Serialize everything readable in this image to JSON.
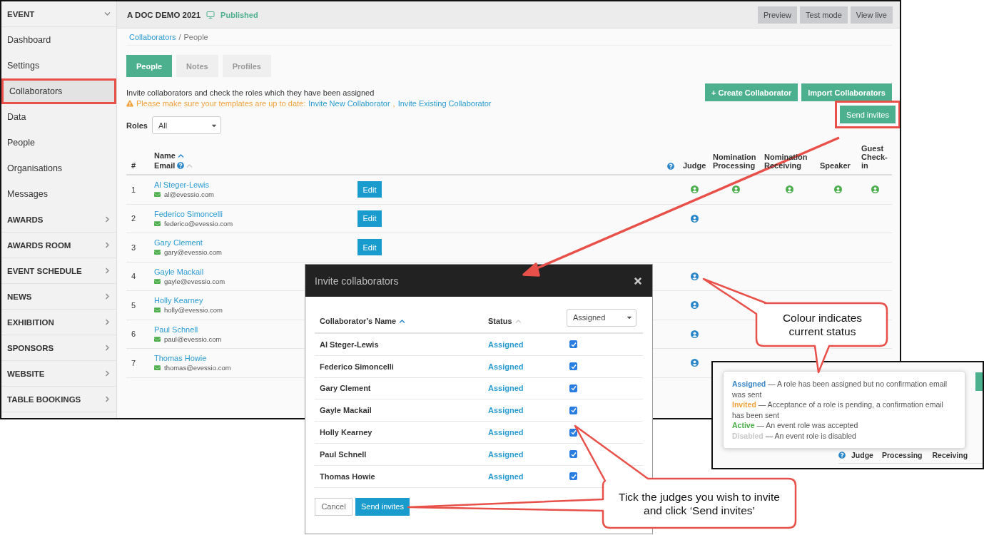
{
  "sidebar": {
    "items": [
      {
        "kind": "header",
        "label": "EVENT",
        "expanded": true,
        "selected": false,
        "annotated": false
      },
      {
        "kind": "link",
        "label": "Dashboard",
        "selected": false,
        "annotated": false
      },
      {
        "kind": "link",
        "label": "Settings",
        "selected": false,
        "annotated": false
      },
      {
        "kind": "link",
        "label": "Collaborators",
        "selected": true,
        "annotated": true
      },
      {
        "kind": "link",
        "label": "Data",
        "selected": false,
        "annotated": false
      },
      {
        "kind": "link",
        "label": "People",
        "selected": false,
        "annotated": false
      },
      {
        "kind": "link",
        "label": "Organisations",
        "selected": false,
        "annotated": false
      },
      {
        "kind": "link",
        "label": "Messages",
        "selected": false,
        "annotated": false
      },
      {
        "kind": "section",
        "label": "AWARDS",
        "expanded": false,
        "selected": false,
        "annotated": false
      },
      {
        "kind": "section",
        "label": "AWARDS ROOM",
        "expanded": false,
        "selected": false,
        "annotated": false
      },
      {
        "kind": "section",
        "label": "EVENT SCHEDULE",
        "expanded": false,
        "selected": false,
        "annotated": false
      },
      {
        "kind": "section",
        "label": "NEWS",
        "expanded": false,
        "selected": false,
        "annotated": false
      },
      {
        "kind": "section",
        "label": "EXHIBITION",
        "expanded": false,
        "selected": false,
        "annotated": false
      },
      {
        "kind": "section",
        "label": "SPONSORS",
        "expanded": false,
        "selected": false,
        "annotated": false
      },
      {
        "kind": "section",
        "label": "WEBSITE",
        "expanded": false,
        "selected": false,
        "annotated": false
      },
      {
        "kind": "section",
        "label": "TABLE BOOKINGS",
        "expanded": false,
        "selected": false,
        "annotated": false
      }
    ]
  },
  "topbar": {
    "title": "A DOC DEMO 2021",
    "status": "Published",
    "buttons": [
      "Preview",
      "Test mode",
      "View live"
    ]
  },
  "breadcrumb": {
    "link": "Collaborators",
    "separator": "/",
    "current": "People"
  },
  "tabs": [
    {
      "label": "People",
      "selected": true
    },
    {
      "label": "Notes",
      "selected": false
    },
    {
      "label": "Profiles",
      "selected": false
    }
  ],
  "description": "Invite collaborators and check the roles which they have been assigned",
  "warning": {
    "text": "Please make sure your templates are up to date:",
    "links": [
      "Invite New Collaborator",
      "Invite Existing Collaborator"
    ],
    "separator": ","
  },
  "actions": [
    "+ Create Collaborator",
    "Import Collaborators"
  ],
  "roles_filter": {
    "label": "Roles",
    "value": "All"
  },
  "send_invites": {
    "label": "Send invites",
    "annotated": true
  },
  "table": {
    "columns": {
      "number": "#",
      "name": "Name",
      "email": "Email",
      "roles": [
        "Judge",
        "Nomination Processing",
        "Nomination Receiving",
        "Speaker",
        "Guest Check-in"
      ]
    },
    "rows": [
      {
        "number": "1",
        "name": "Al Steger-Lewis",
        "email": "al@evessio.com",
        "edit": "Edit",
        "roles": [
          {
            "icon": true,
            "color": "#4cae4c"
          },
          {
            "icon": true,
            "color": "#4cae4c"
          },
          {
            "icon": true,
            "color": "#4cae4c"
          },
          {
            "icon": true,
            "color": "#4cae4c"
          },
          {
            "icon": true,
            "color": "#4cae4c"
          }
        ]
      },
      {
        "number": "2",
        "name": "Federico Simoncelli",
        "email": "federico@evessio.com",
        "edit": "Edit",
        "roles": [
          {
            "icon": true,
            "color": "#2a86c9"
          },
          {
            "icon": false
          },
          {
            "icon": false
          },
          {
            "icon": false
          },
          {
            "icon": false
          }
        ]
      },
      {
        "number": "3",
        "name": "Gary Clement",
        "email": "gary@evessio.com",
        "edit": "Edit",
        "roles": [
          {
            "icon": false
          },
          {
            "icon": false
          },
          {
            "icon": false
          },
          {
            "icon": false
          },
          {
            "icon": false
          }
        ]
      },
      {
        "number": "4",
        "name": "Gayle Mackail",
        "email": "gayle@evessio.com",
        "roles": [
          {
            "icon": true,
            "color": "#2a86c9"
          },
          {
            "icon": false
          },
          {
            "icon": false
          },
          {
            "icon": false
          },
          {
            "icon": false
          }
        ]
      },
      {
        "number": "5",
        "name": "Holly Kearney",
        "email": "holly@evessio.com",
        "roles": [
          {
            "icon": true,
            "color": "#2a86c9"
          },
          {
            "icon": false
          },
          {
            "icon": false
          },
          {
            "icon": false
          },
          {
            "icon": false
          }
        ]
      },
      {
        "number": "6",
        "name": "Paul Schnell",
        "email": "paul@evessio.com",
        "roles": [
          {
            "icon": true,
            "color": "#2a86c9"
          },
          {
            "icon": false
          },
          {
            "icon": false
          },
          {
            "icon": false
          },
          {
            "icon": false
          }
        ]
      },
      {
        "number": "7",
        "name": "Thomas Howie",
        "email": "thomas@evessio.com",
        "roles": [
          {
            "icon": true,
            "color": "#2a86c9"
          },
          {
            "icon": false
          },
          {
            "icon": false
          },
          {
            "icon": false
          },
          {
            "icon": false
          }
        ]
      }
    ]
  },
  "modal": {
    "title": "Invite collaborators",
    "columns": {
      "name": "Collaborator's Name",
      "status": "Status"
    },
    "filter": "Assigned",
    "rows": [
      {
        "name": "Al Steger-Lewis",
        "status": "Assigned",
        "checked": true
      },
      {
        "name": "Federico Simoncelli",
        "status": "Assigned",
        "checked": true
      },
      {
        "name": "Gary Clement",
        "status": "Assigned",
        "checked": true
      },
      {
        "name": "Gayle Mackail",
        "status": "Assigned",
        "checked": true
      },
      {
        "name": "Holly Kearney",
        "status": "Assigned",
        "checked": true
      },
      {
        "name": "Paul Schnell",
        "status": "Assigned",
        "checked": true
      },
      {
        "name": "Thomas Howie",
        "status": "Assigned",
        "checked": true
      }
    ],
    "buttons": [
      "Cancel",
      "Send invites"
    ]
  },
  "inset": {
    "legend": [
      {
        "term": "Assigned",
        "text": " — A role has been assigned but no confirmation email was sent",
        "color": "#3a86c9"
      },
      {
        "term": "Invited",
        "text": " — Acceptance of a role is pending, a confirmation email has been sent",
        "color": "#f0a23c"
      },
      {
        "term": "Active",
        "text": " — An event role was accepted",
        "color": "#4cae4c"
      },
      {
        "term": "Disabled",
        "text": " — An event role is disabled",
        "color": "#c8c8c8"
      }
    ],
    "columns": [
      "Judge",
      "Processing",
      "Receiving"
    ]
  },
  "callouts": [
    "Colour indicates current status",
    "Tick the judges you wish to invite and click ‘Send invites’"
  ]
}
